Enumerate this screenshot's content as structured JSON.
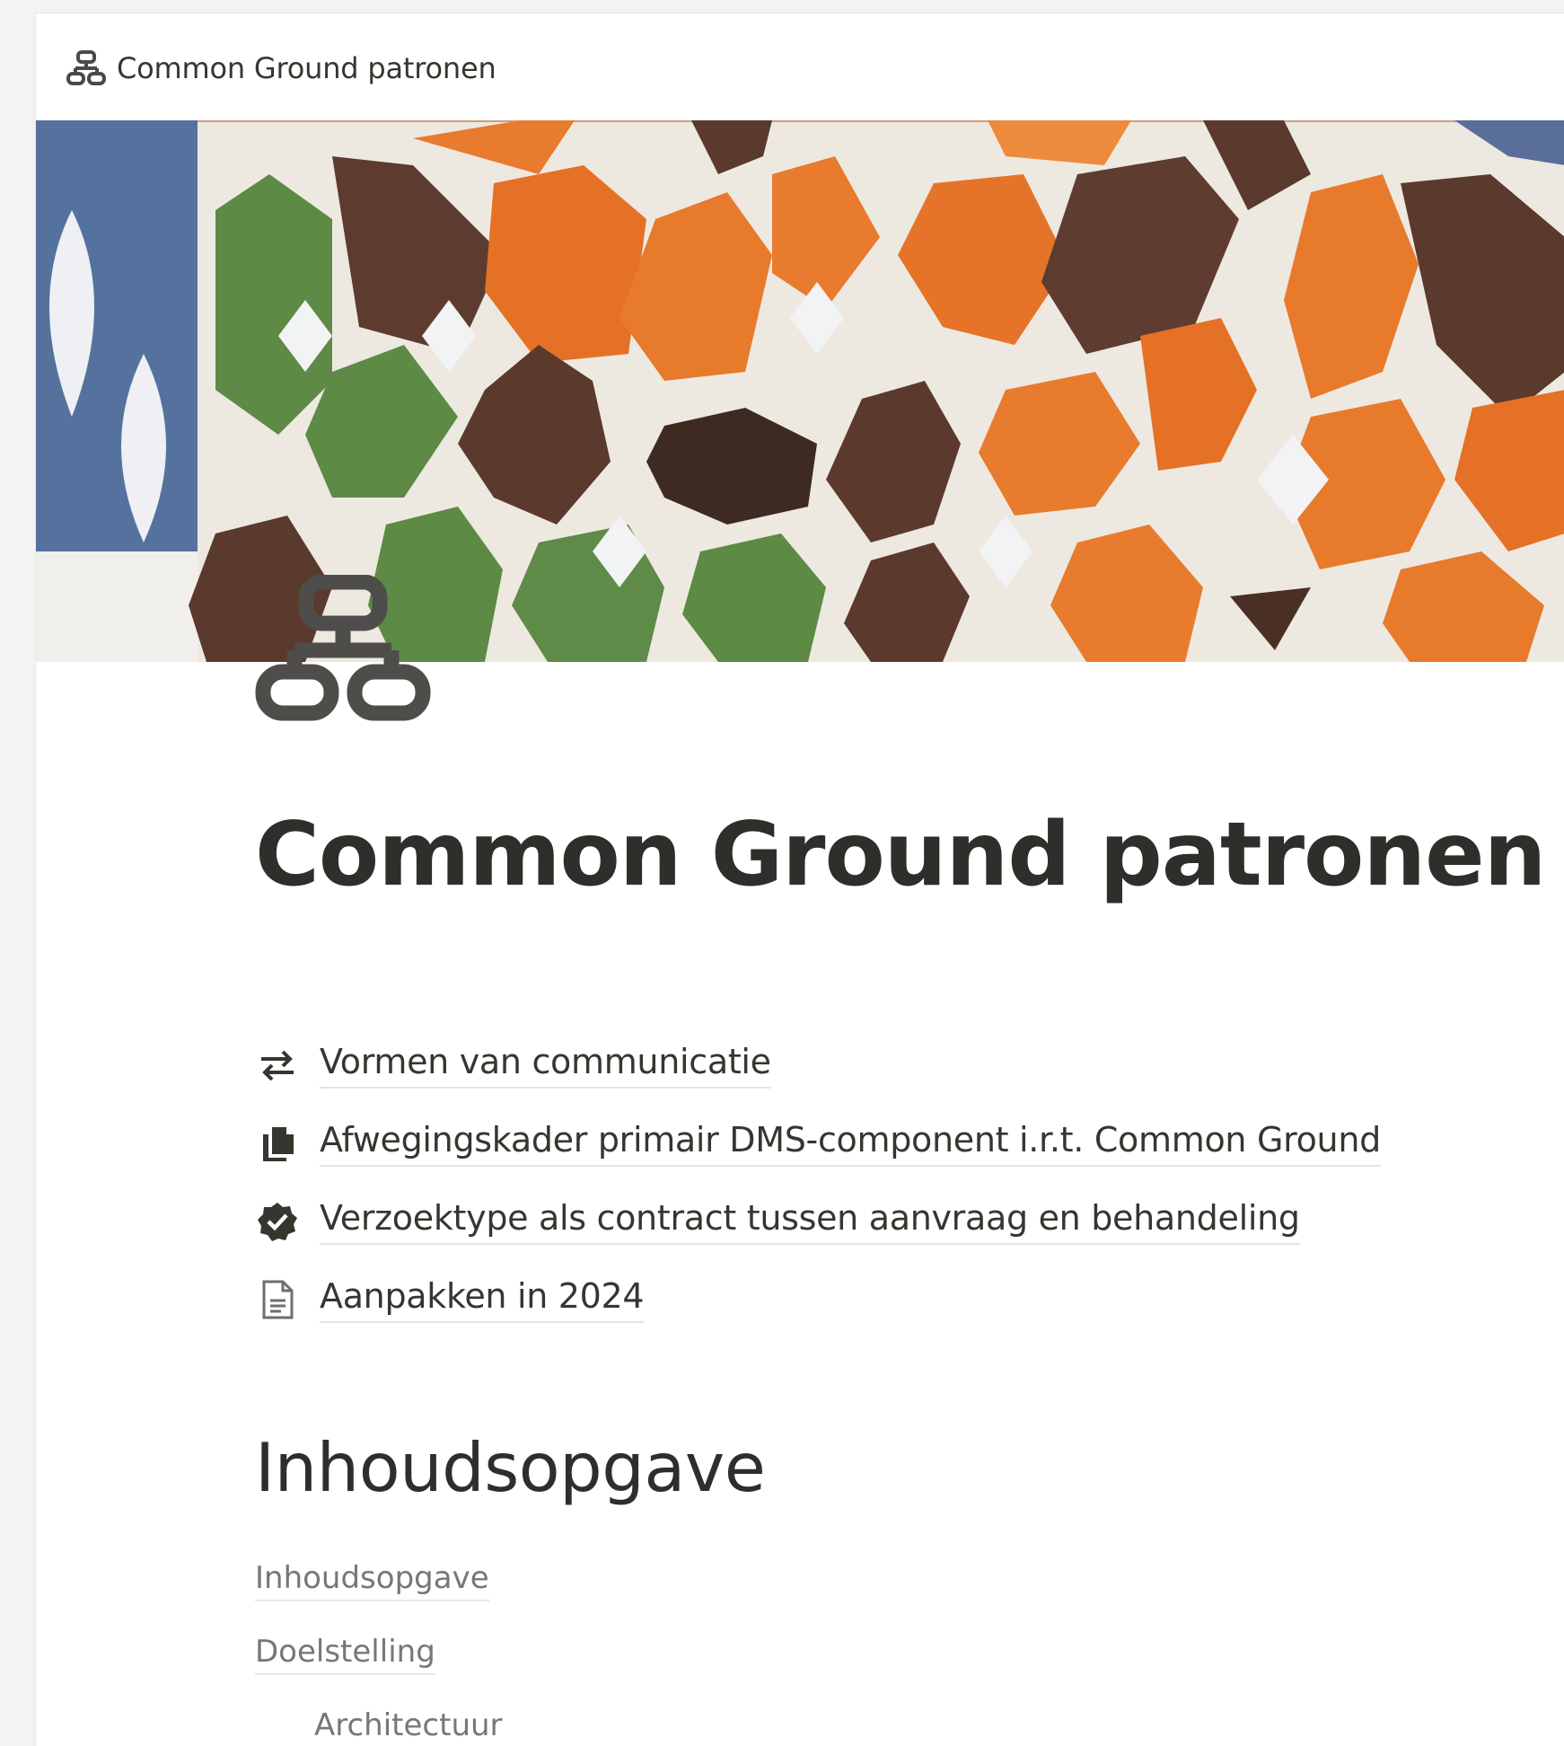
{
  "breadcrumb": {
    "icon": "sitemap-icon",
    "label": "Common Ground patronen"
  },
  "cover": {
    "description": "mosaic-tile-cover",
    "colors": [
      "#e8732a",
      "#5d3a2e",
      "#5f8a46",
      "#4e6aa0",
      "#eef0f2"
    ]
  },
  "page": {
    "icon": "sitemap-icon",
    "title": "Common Ground patronen"
  },
  "links": [
    {
      "icon": "arrows-exchange-icon",
      "label": "Vormen van communicatie"
    },
    {
      "icon": "documents-stack-icon",
      "label": "Afwegingskader primair DMS-component i.r.t. Common Ground"
    },
    {
      "icon": "verified-badge-icon",
      "label": "Verzoektype als contract tussen aanvraag en behandeling"
    },
    {
      "icon": "document-icon",
      "label": "Aanpakken in 2024"
    }
  ],
  "heading": "Inhoudsopgave",
  "toc": [
    {
      "label": "Inhoudsopgave",
      "level": 1
    },
    {
      "label": "Doelstelling",
      "level": 1
    },
    {
      "label": "Architectuur",
      "level": 2
    }
  ]
}
